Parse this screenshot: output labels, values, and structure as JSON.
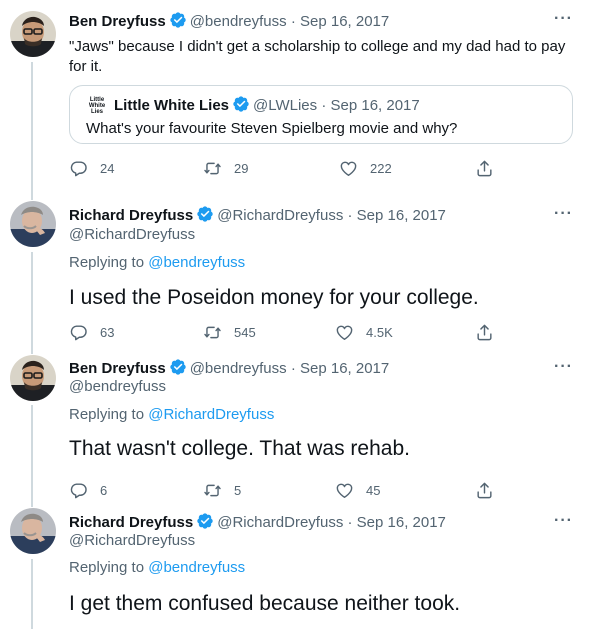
{
  "tweets": [
    {
      "name": "Ben Dreyfuss",
      "handle": "@bendreyfuss",
      "separator": "·",
      "date": "Sep 16, 2017",
      "more": "···",
      "text": "\"Jaws\" because I didn't get a scholarship to college and my dad had to pay for it.",
      "quote": {
        "logo_text": "Little White Lies",
        "name": "Little White Lies",
        "handle": "@LWLies",
        "separator": "·",
        "date": "Sep 16, 2017",
        "text": "What's your favourite Steven Spielberg movie and why?"
      },
      "stats": {
        "replies": "24",
        "retweets": "29",
        "likes": "222"
      }
    },
    {
      "name": "Richard Dreyfuss",
      "handle": "@RichardDreyfuss",
      "separator": "·",
      "date": "Sep 16, 2017",
      "more": "···",
      "handle_line": "@RichardDreyfuss",
      "replying_prefix": "Replying to ",
      "replying_to": "@bendreyfuss",
      "text": "I used the Poseidon money for your college.",
      "stats": {
        "replies": "63",
        "retweets": "545",
        "likes": "4.5K"
      }
    },
    {
      "name": "Ben Dreyfuss",
      "handle": "@bendreyfuss",
      "separator": "·",
      "date": "Sep 16, 2017",
      "more": "···",
      "handle_line": "@bendreyfuss",
      "replying_prefix": "Replying to ",
      "replying_to": "@RichardDreyfuss",
      "text": "That wasn't college. That was rehab.",
      "stats": {
        "replies": "6",
        "retweets": "5",
        "likes": "45"
      }
    },
    {
      "name": "Richard Dreyfuss",
      "handle": "@RichardDreyfuss",
      "separator": "·",
      "date": "Sep 16, 2017",
      "more": "···",
      "handle_line": "@RichardDreyfuss",
      "replying_prefix": "Replying to ",
      "replying_to": "@bendreyfuss",
      "text": "I get them confused because neither took."
    }
  ],
  "icons": {
    "reply": "reply-icon",
    "retweet": "retweet-icon",
    "like": "heart-icon",
    "share": "share-icon",
    "verified": "verified-badge-icon"
  },
  "colors": {
    "accent": "#1d9bf0",
    "text": "#0f1419",
    "secondary": "#536471",
    "border": "#cfd9de"
  }
}
